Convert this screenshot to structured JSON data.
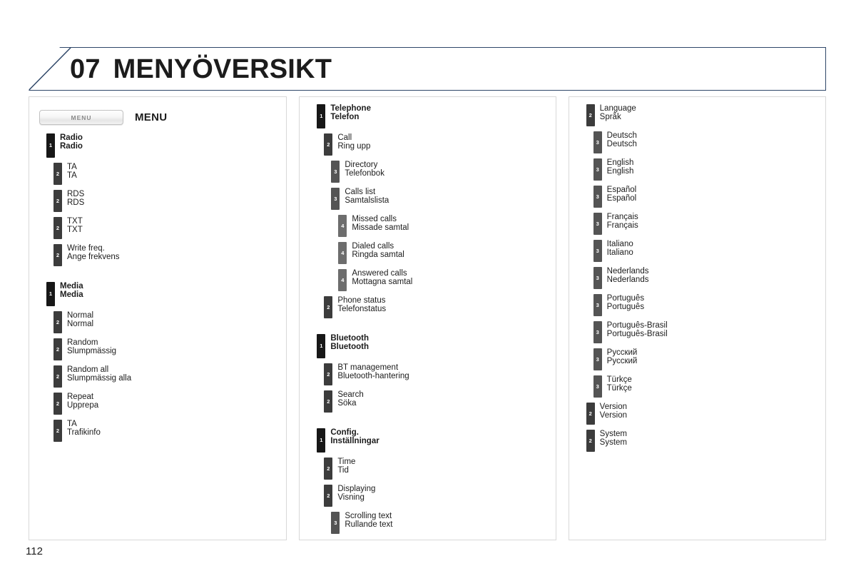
{
  "page": {
    "number": "112",
    "chapter_number": "07",
    "chapter_title": "MENYÖVERSIKT"
  },
  "colors": {
    "header_border": "#2e4668",
    "panel_border": "#d8d8d8",
    "level_1_bar": "#171717",
    "level_2_bar": "#3c3c3c",
    "level_3_bar": "#545454",
    "level_4_bar": "#6d6d6d",
    "text": "#1c1c1c",
    "background": "#ffffff"
  },
  "menu_key": {
    "button_label": "MENU",
    "caption": "MENU"
  },
  "columns": [
    {
      "id": "column-radio-media",
      "items": [
        {
          "level": "1",
          "en": "Radio",
          "sv": "Radio",
          "gap": false
        },
        {
          "level": "2",
          "en": "TA",
          "sv": "TA",
          "gap": false
        },
        {
          "level": "2",
          "en": "RDS",
          "sv": "RDS",
          "gap": false
        },
        {
          "level": "2",
          "en": "TXT",
          "sv": "TXT",
          "gap": false
        },
        {
          "level": "2",
          "en": "Write freq.",
          "sv": "Ange frekvens",
          "gap": false
        },
        {
          "level": "1",
          "en": "Media",
          "sv": "Media",
          "gap": true
        },
        {
          "level": "2",
          "en": "Normal",
          "sv": "Normal",
          "gap": false
        },
        {
          "level": "2",
          "en": "Random",
          "sv": "Slumpmässig",
          "gap": false
        },
        {
          "level": "2",
          "en": "Random all",
          "sv": "Slumpmässig alla",
          "gap": false
        },
        {
          "level": "2",
          "en": "Repeat",
          "sv": "Upprepa",
          "gap": false
        },
        {
          "level": "2",
          "en": "TA",
          "sv": "Trafikinfo",
          "gap": false
        }
      ]
    },
    {
      "id": "column-telephone-bluetooth-config",
      "items": [
        {
          "level": "1",
          "en": "Telephone",
          "sv": "Telefon",
          "gap": false
        },
        {
          "level": "2",
          "en": "Call",
          "sv": "Ring upp",
          "gap": false
        },
        {
          "level": "3",
          "en": "Directory",
          "sv": "Telefonbok",
          "gap": false
        },
        {
          "level": "3",
          "en": "Calls list",
          "sv": "Samtalslista",
          "gap": false
        },
        {
          "level": "4",
          "en": "Missed calls",
          "sv": "Missade samtal",
          "gap": false
        },
        {
          "level": "4",
          "en": "Dialed calls",
          "sv": "Ringda samtal",
          "gap": false
        },
        {
          "level": "4",
          "en": "Answered calls",
          "sv": "Mottagna samtal",
          "gap": false
        },
        {
          "level": "2",
          "en": "Phone status",
          "sv": "Telefonstatus",
          "gap": false
        },
        {
          "level": "1",
          "en": "Bluetooth",
          "sv": "Bluetooth",
          "gap": true
        },
        {
          "level": "2",
          "en": "BT management",
          "sv": "Bluetooth-hantering",
          "gap": false
        },
        {
          "level": "2",
          "en": "Search",
          "sv": "Söka",
          "gap": false
        },
        {
          "level": "1",
          "en": "Config.",
          "sv": "Inställningar",
          "gap": true
        },
        {
          "level": "2",
          "en": "Time",
          "sv": "Tid",
          "gap": false
        },
        {
          "level": "2",
          "en": "Displaying",
          "sv": "Visning",
          "gap": false
        },
        {
          "level": "3",
          "en": "Scrolling text",
          "sv": "Rullande text",
          "gap": false
        }
      ]
    },
    {
      "id": "column-language-version-system",
      "items": [
        {
          "level": "2",
          "en": "Language",
          "sv": "Språk",
          "gap": false
        },
        {
          "level": "3",
          "en": "Deutsch",
          "sv": "Deutsch",
          "gap": false
        },
        {
          "level": "3",
          "en": "English",
          "sv": "English",
          "gap": false
        },
        {
          "level": "3",
          "en": "Español",
          "sv": "Español",
          "gap": false
        },
        {
          "level": "3",
          "en": "Français",
          "sv": "Français",
          "gap": false
        },
        {
          "level": "3",
          "en": "Italiano",
          "sv": "Italiano",
          "gap": false
        },
        {
          "level": "3",
          "en": "Nederlands",
          "sv": "Nederlands",
          "gap": false
        },
        {
          "level": "3",
          "en": "Português",
          "sv": "Português",
          "gap": false
        },
        {
          "level": "3",
          "en": "Português-Brasil",
          "sv": "Português-Brasil",
          "gap": false
        },
        {
          "level": "3",
          "en": "Русский",
          "sv": "Русский",
          "gap": false
        },
        {
          "level": "3",
          "en": "Türkçe",
          "sv": "Türkçe",
          "gap": false
        },
        {
          "level": "2",
          "en": "Version",
          "sv": "Version",
          "gap": false
        },
        {
          "level": "2",
          "en": "System",
          "sv": "System",
          "gap": false
        }
      ]
    }
  ]
}
